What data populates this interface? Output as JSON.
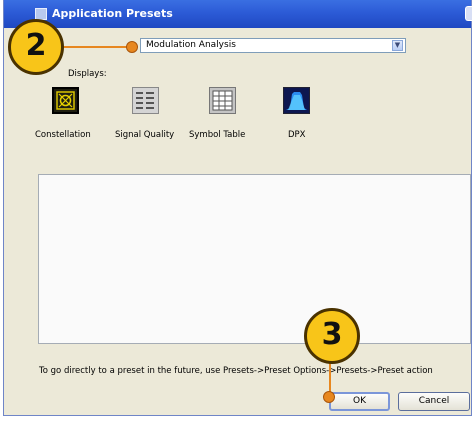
{
  "window": {
    "title": "Application Presets"
  },
  "preset_select": {
    "value": "Modulation Analysis"
  },
  "displays": {
    "label": "Displays:",
    "items": [
      {
        "label": "Constellation",
        "icon": "constellation-icon"
      },
      {
        "label": "Signal Quality",
        "icon": "signal-quality-icon"
      },
      {
        "label": "Symbol Table",
        "icon": "symbol-table-icon"
      },
      {
        "label": "DPX",
        "icon": "dpx-spectrum-icon"
      }
    ]
  },
  "hint": "To go directly to a preset in the future, use Presets->Preset Options->Presets->Preset action",
  "buttons": {
    "ok": "OK",
    "cancel": "Cancel"
  },
  "callouts": [
    {
      "number": "2"
    },
    {
      "number": "3"
    }
  ],
  "colors": {
    "callout_fill": "#f8c519",
    "callout_line": "#e7871f",
    "titlebar": "#2c5bd6",
    "dialog_bg": "#ece9d8"
  }
}
